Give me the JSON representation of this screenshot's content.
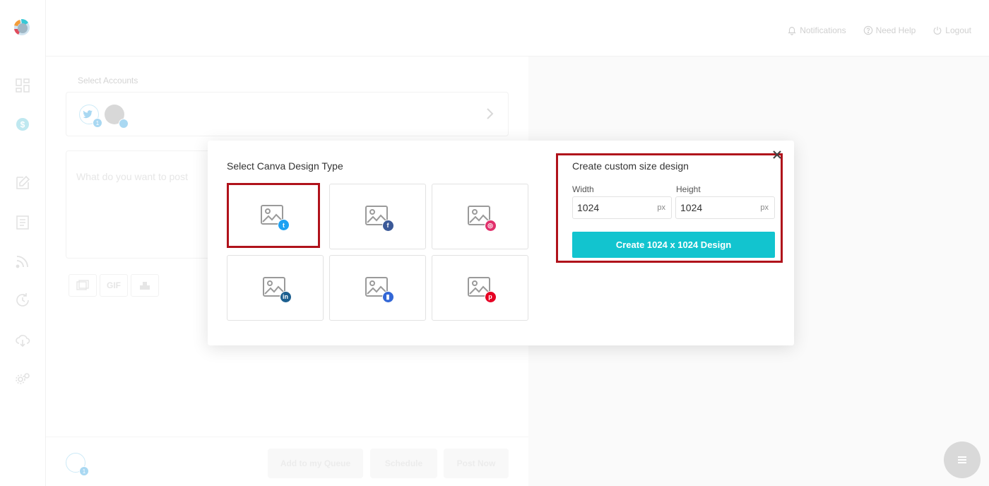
{
  "header": {
    "notifications_label": "Notifications",
    "help_label": "Need Help",
    "logout_label": "Logout"
  },
  "composer": {
    "select_accounts_label": "Select Accounts",
    "account_badge_count": "1",
    "post_placeholder": "What do you want to post",
    "gif_label": "GIF",
    "footer_badge_count": "1",
    "add_queue_label": "Add to my Queue",
    "schedule_label": "Schedule",
    "post_now_label": "Post Now"
  },
  "modal": {
    "design_type_title": "Select Canva Design Type",
    "tiles": [
      {
        "network": "twitter",
        "icon": "twitter-icon",
        "color": "#1da1f2",
        "glyph": "t"
      },
      {
        "network": "facebook",
        "icon": "facebook-icon",
        "color": "#3b5998",
        "glyph": "f"
      },
      {
        "network": "instagram",
        "icon": "instagram-icon",
        "color": "#e1306c",
        "glyph": "◎"
      },
      {
        "network": "linkedin",
        "icon": "linkedin-icon",
        "color": "#1c5f8f",
        "glyph": "in"
      },
      {
        "network": "google-my-business",
        "icon": "google-my-business-icon",
        "color": "#3367d6",
        "glyph": "▮"
      },
      {
        "network": "pinterest",
        "icon": "pinterest-icon",
        "color": "#e60023",
        "glyph": "p"
      }
    ],
    "custom_title": "Create custom size design",
    "width_label": "Width",
    "width_value": "1024",
    "height_label": "Height",
    "height_value": "1024",
    "unit": "px",
    "create_button_label": "Create 1024 x 1024 Design"
  },
  "colors": {
    "accent": "#12c4cf",
    "highlight": "#b0121b"
  }
}
